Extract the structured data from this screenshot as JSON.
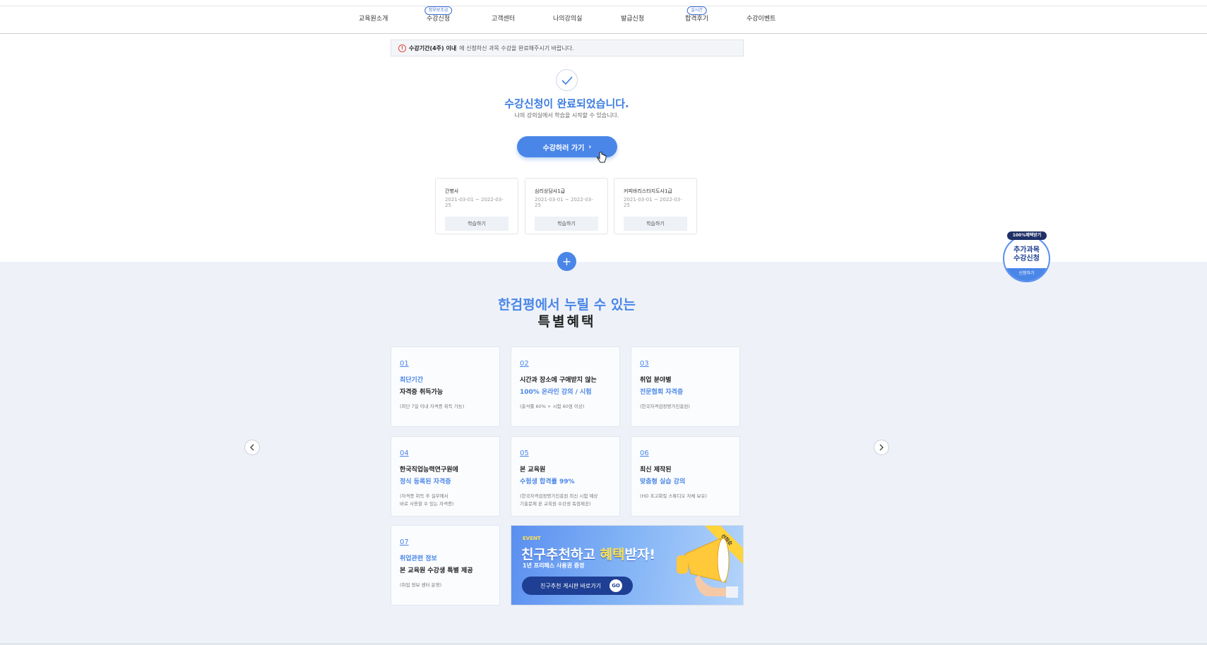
{
  "nav": {
    "items": [
      {
        "label": "교육원소개",
        "badge": ""
      },
      {
        "label": "수강신청",
        "badge": "정부보조금"
      },
      {
        "label": "고객센터",
        "badge": ""
      },
      {
        "label": "나의강의실",
        "badge": ""
      },
      {
        "label": "발급신청",
        "badge": ""
      },
      {
        "label": "합격후기",
        "badge": "실시간"
      },
      {
        "label": "수강이벤트",
        "badge": ""
      }
    ]
  },
  "notice": {
    "icon": "info-icon",
    "bold": "수강기간(4주) 이내",
    "text": "에 신청하신 과목 수강을 완료해주시기 바랍니다."
  },
  "complete": {
    "title": "수강신청이 완료되었습니다.",
    "subtitle": "나의 강의실에서 학습을 시작할 수 있습니다.",
    "button": "수강하러 가기"
  },
  "courses": [
    {
      "name": "간병사",
      "period": "2021-03-01 ~ 2022-03-25",
      "action": "학습하기"
    },
    {
      "name": "심리상담사1급",
      "period": "2021-03-01 ~ 2022-03-25",
      "action": "학습하기"
    },
    {
      "name": "커피바리스타지도사1급",
      "period": "2021-03-01 ~ 2022-03-25",
      "action": "학습하기"
    }
  ],
  "plus_label": "+",
  "benefits": {
    "title_line1": "한검평에서 누릴 수 있는",
    "title_line2": "특별혜택",
    "cards": [
      {
        "num": "01",
        "line1": "최단기간",
        "line2": "자격증 취득가능",
        "note": "(최단 7일 이내 자격증 취득 가능)"
      },
      {
        "num": "02",
        "line1": "시간과 장소에 구애받지 않는",
        "line2": "100% 온라인 강의 / 시험",
        "note": "(출석률 60% + 시험 60점 이상)"
      },
      {
        "num": "03",
        "line1": "취업 분야별",
        "line2": "전문협회 자격증",
        "note": "(한국자격검정평가진흥원)"
      },
      {
        "num": "04",
        "line1": "한국직업능력연구원에",
        "line2": "정식 등록된 자격증",
        "note": "(자격증 취득 후 실무에서\n바로 사용할 수 있는 자격증)"
      },
      {
        "num": "05",
        "line1": "본 교육원",
        "line2": "수험생 합격률 99%",
        "note": "(한국자격검정평가진흥원 최신 시험 예상\n기출문제 본 교육원 수강생 독점제공)"
      },
      {
        "num": "06",
        "line1": "최신 제작된",
        "line2": "맞춤형 실습 강의",
        "note": "(HD 초고화질 스튜디오 자체 보유)"
      },
      {
        "num": "07",
        "line1": "취업관련 정보",
        "line2": "본 교육원 수강생 특별 제공",
        "note": "(취업 정보 센터 운영)"
      }
    ]
  },
  "event": {
    "tag": "EVENT",
    "head_a": "친구추천",
    "head_b": "하고 ",
    "head_c": "혜택",
    "head_d": "받자!",
    "sub": "1년 프리패스 사용권 증정",
    "button": "친구추천 게시판 바로가기",
    "go": "GO",
    "ribbon": "선착순"
  },
  "float_badge": {
    "top": "100%혜택받기",
    "line1": "추가과목",
    "line2": "수강신청",
    "foot": "신청하기"
  }
}
